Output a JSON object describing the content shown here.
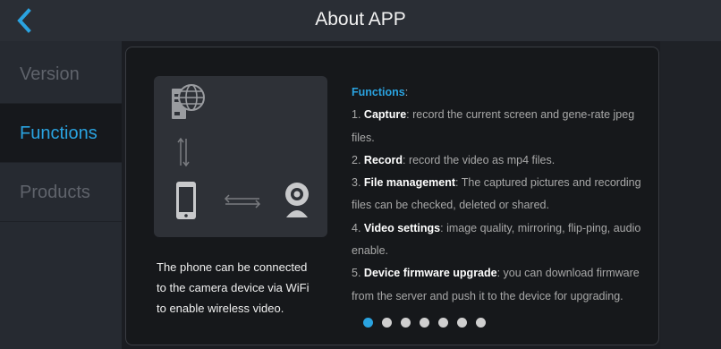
{
  "header": {
    "title": "About APP",
    "back_icon": "back-arrow-icon",
    "accent": "#2aa3e0"
  },
  "sidebar": {
    "items": [
      {
        "label": "Version",
        "active": false
      },
      {
        "label": "Functions",
        "active": true
      },
      {
        "label": "Products",
        "active": false
      }
    ]
  },
  "content": {
    "illustration_icons": [
      "server-globe-icon",
      "transfer-arrows-icon",
      "phone-icon",
      "camera-icon"
    ],
    "description_lines": [
      "The phone can be connected",
      "to the camera device via WiFi",
      "to enable wireless video."
    ],
    "functions": {
      "heading": "Functions",
      "heading_suffix": ":",
      "items": [
        {
          "number": "1.",
          "name": "Capture",
          "text": ": record the current screen and gene-rate jpeg files."
        },
        {
          "number": "2.",
          "name": "Record",
          "text": ": record the video as mp4 files."
        },
        {
          "number": "3.",
          "name": "File management",
          "text": ": The captured pictures and recording files can be checked, deleted or shared."
        },
        {
          "number": "4.",
          "name": "Video settings",
          "text": ": image quality, mirroring, flip-ping, audio enable."
        },
        {
          "number": "5.",
          "name": "Device firmware upgrade",
          "text": ": you can download firmware from the server and push it to the device for upgrading."
        }
      ]
    },
    "pager": {
      "count": 7,
      "active_index": 0
    }
  }
}
